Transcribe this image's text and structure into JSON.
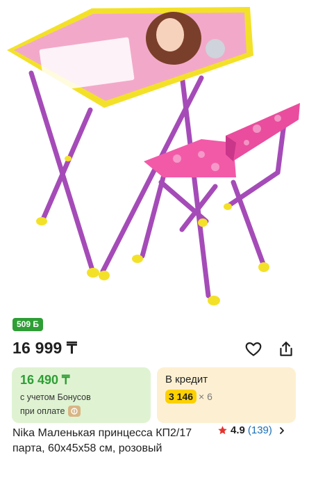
{
  "product": {
    "bonus_badge": "509 Б",
    "price": "16 999 ₸",
    "title": "Nika Маленькая принцесса КП2/17 парта, 60х45х58 см, розовый"
  },
  "bonus_card": {
    "amount": "16 490 ₸",
    "line1": "с учетом Бонусов",
    "line2": "при оплате"
  },
  "credit_card": {
    "title": "В кредит",
    "monthly": "3 146",
    "term": "× 6"
  },
  "rating": {
    "score": "4.9",
    "reviews": "(139)"
  },
  "icons": [
    "heart-icon",
    "share-icon",
    "coin-icon",
    "star-icon",
    "chevron-right-icon"
  ],
  "colors": {
    "green": "#2e9e35",
    "green_bg": "#dff3d2",
    "credit_bg": "#fdf0d2",
    "yellow": "#fcd100",
    "star": "#e3342f",
    "link": "#1a6fb5"
  }
}
